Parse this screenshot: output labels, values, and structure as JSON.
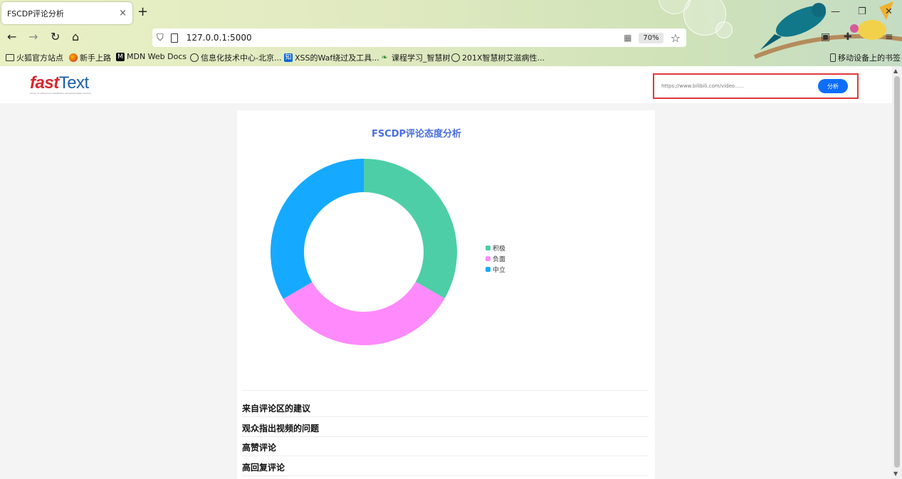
{
  "browser": {
    "tab_title": "FSCDP评论分析",
    "tab_close": "×",
    "new_tab": "+",
    "url": "127.0.0.1:5000",
    "zoom": "70%",
    "bookmarks": [
      {
        "label": "火狐官方站点",
        "icon": "folder-icon"
      },
      {
        "label": "新手上路",
        "icon": "firefox-icon"
      },
      {
        "label": "MDN Web Docs",
        "icon": "mdn-icon"
      },
      {
        "label": "信息化技术中心-北京...",
        "icon": "globe-icon"
      },
      {
        "label": "XSS的Waf绕过及工具...",
        "icon": "zhihu-icon"
      },
      {
        "label": "课程学习_智慧树",
        "icon": "leaf-icon"
      },
      {
        "label": "201X智慧树艾滋病性...",
        "icon": "globe-icon"
      }
    ],
    "mobile_bookmarks": "移动设备上的书签"
  },
  "header": {
    "logo_fast": "fast",
    "logo_text": "Text",
    "logo_tagline": "Library for efficient text classification and representation learning",
    "search_placeholder": "https://www.bilibili.com/video......",
    "search_button": "分析"
  },
  "colors": {
    "positive": "#4dcea7",
    "negative": "#ff8afb",
    "neutral": "#15aaff",
    "title": "#4a6ee0"
  },
  "chart_data": {
    "type": "pie",
    "variant": "donut",
    "title": "FSCDP评论态度分析",
    "categories": [
      "积极",
      "负面",
      "中立"
    ],
    "values": [
      33.3,
      33.3,
      33.4
    ],
    "legend": "right",
    "start_angle": "top",
    "direction": "clockwise"
  },
  "sections": [
    {
      "title": "来自评论区的建议"
    },
    {
      "title": "观众指出视频的问题"
    },
    {
      "title": "高赞评论"
    },
    {
      "title": "高回复评论"
    }
  ]
}
